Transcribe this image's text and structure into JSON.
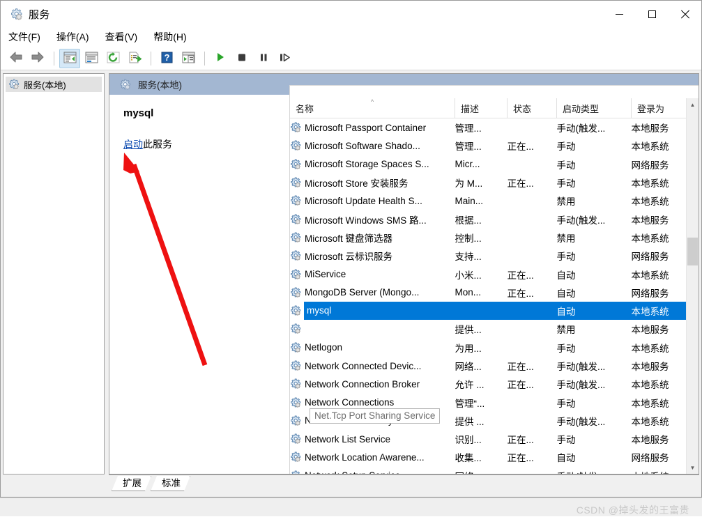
{
  "window": {
    "title": "服务",
    "title_icon": "services-gear-icon",
    "controls": {
      "minimize": "最小化",
      "maximize": "最大化",
      "close": "关闭"
    }
  },
  "menubar": [
    {
      "label": "文件(F)",
      "name": "menu-file"
    },
    {
      "label": "操作(A)",
      "name": "menu-action"
    },
    {
      "label": "查看(V)",
      "name": "menu-view"
    },
    {
      "label": "帮助(H)",
      "name": "menu-help"
    }
  ],
  "toolbar": [
    {
      "name": "back-icon",
      "label": "后退"
    },
    {
      "name": "forward-icon",
      "label": "前进"
    },
    {
      "name": "show-hide-tree-icon",
      "label": "显示/隐藏控制台树",
      "active": true
    },
    {
      "name": "properties-icon",
      "label": "属性"
    },
    {
      "name": "refresh-icon",
      "label": "刷新"
    },
    {
      "name": "export-list-icon",
      "label": "导出列表"
    },
    {
      "name": "help-icon",
      "label": "帮助"
    },
    {
      "name": "show-action-pane-icon",
      "label": "显示操作窗格"
    },
    {
      "name": "start-service-icon",
      "label": "启动服务"
    },
    {
      "name": "stop-service-icon",
      "label": "停止服务"
    },
    {
      "name": "pause-service-icon",
      "label": "暂停服务"
    },
    {
      "name": "restart-service-icon",
      "label": "重启服务"
    }
  ],
  "tree": {
    "items": [
      {
        "label": "服务(本地)",
        "icon": "services-gear-icon",
        "selected": true
      }
    ]
  },
  "right_pane": {
    "header_title": "服务(本地)",
    "header_icon": "services-gear-icon",
    "header_color": "#a3b7d2"
  },
  "detail": {
    "service_name": "mysql",
    "action_link": "启动",
    "action_suffix": "此服务"
  },
  "list": {
    "columns": [
      {
        "label": "名称",
        "name": "column-name",
        "sorted": "asc"
      },
      {
        "label": "描述",
        "name": "column-description"
      },
      {
        "label": "状态",
        "name": "column-status"
      },
      {
        "label": "启动类型",
        "name": "column-startup-type"
      },
      {
        "label": "登录为",
        "name": "column-logon-as"
      },
      {
        "label": "",
        "name": "column-filler"
      }
    ],
    "rows": [
      {
        "name": "Microsoft Passport Container",
        "desc": "管理...",
        "status": "",
        "startup": "手动(触发...",
        "logon": "本地服务"
      },
      {
        "name": "Microsoft Software Shado...",
        "desc": "管理...",
        "status": "正在...",
        "startup": "手动",
        "logon": "本地系统"
      },
      {
        "name": "Microsoft Storage Spaces S...",
        "desc": "Micr...",
        "status": "",
        "startup": "手动",
        "logon": "网络服务"
      },
      {
        "name": "Microsoft Store 安装服务",
        "desc": "为 M...",
        "status": "正在...",
        "startup": "手动",
        "logon": "本地系统"
      },
      {
        "name": "Microsoft Update Health S...",
        "desc": "Main...",
        "status": "",
        "startup": "禁用",
        "logon": "本地系统"
      },
      {
        "name": "Microsoft Windows SMS 路...",
        "desc": "根据...",
        "status": "",
        "startup": "手动(触发...",
        "logon": "本地服务"
      },
      {
        "name": "Microsoft 键盘筛选器",
        "desc": "控制...",
        "status": "",
        "startup": "禁用",
        "logon": "本地系统"
      },
      {
        "name": "Microsoft 云标识服务",
        "desc": "支持...",
        "status": "",
        "startup": "手动",
        "logon": "网络服务"
      },
      {
        "name": "MiService",
        "desc": "小米...",
        "status": "正在...",
        "startup": "自动",
        "logon": "本地系统"
      },
      {
        "name": "MongoDB Server (Mongo...",
        "desc": "Mon...",
        "status": "正在...",
        "startup": "自动",
        "logon": "网络服务"
      },
      {
        "name": "mysql",
        "desc": "",
        "status": "",
        "startup": "自动",
        "logon": "本地系统",
        "selected": true
      },
      {
        "name": "Net.Tcp Port Sharing Service",
        "desc": "提供...",
        "status": "",
        "startup": "禁用",
        "logon": "本地服务",
        "name_hidden": true
      },
      {
        "name": "Netlogon",
        "desc": "为用...",
        "status": "",
        "startup": "手动",
        "logon": "本地系统"
      },
      {
        "name": "Network Connected Devic...",
        "desc": "网络...",
        "status": "正在...",
        "startup": "手动(触发...",
        "logon": "本地服务"
      },
      {
        "name": "Network Connection Broker",
        "desc": "允许 ...",
        "status": "正在...",
        "startup": "手动(触发...",
        "logon": "本地系统"
      },
      {
        "name": "Network Connections",
        "desc": "管理“...",
        "status": "",
        "startup": "手动",
        "logon": "本地系统"
      },
      {
        "name": "Network Connectivity Assis...",
        "desc": "提供 ...",
        "status": "",
        "startup": "手动(触发...",
        "logon": "本地系统"
      },
      {
        "name": "Network List Service",
        "desc": "识别...",
        "status": "正在...",
        "startup": "手动",
        "logon": "本地服务"
      },
      {
        "name": "Network Location Awarene...",
        "desc": "收集...",
        "status": "正在...",
        "startup": "自动",
        "logon": "网络服务"
      },
      {
        "name": "Network Setup Service",
        "desc": "网络...",
        "status": "",
        "startup": "手动(触发...",
        "logon": "本地系统"
      }
    ],
    "tooltip": "Net.Tcp Port Sharing Service",
    "selection_color": "#0078d7"
  },
  "tabs": [
    {
      "label": "扩展",
      "name": "tab-extended",
      "active": false
    },
    {
      "label": "标准",
      "name": "tab-standard",
      "active": true
    }
  ],
  "watermark": "CSDN @掉头发的王富贵",
  "annotation": {
    "color": "#ee1111",
    "type": "arrow"
  }
}
